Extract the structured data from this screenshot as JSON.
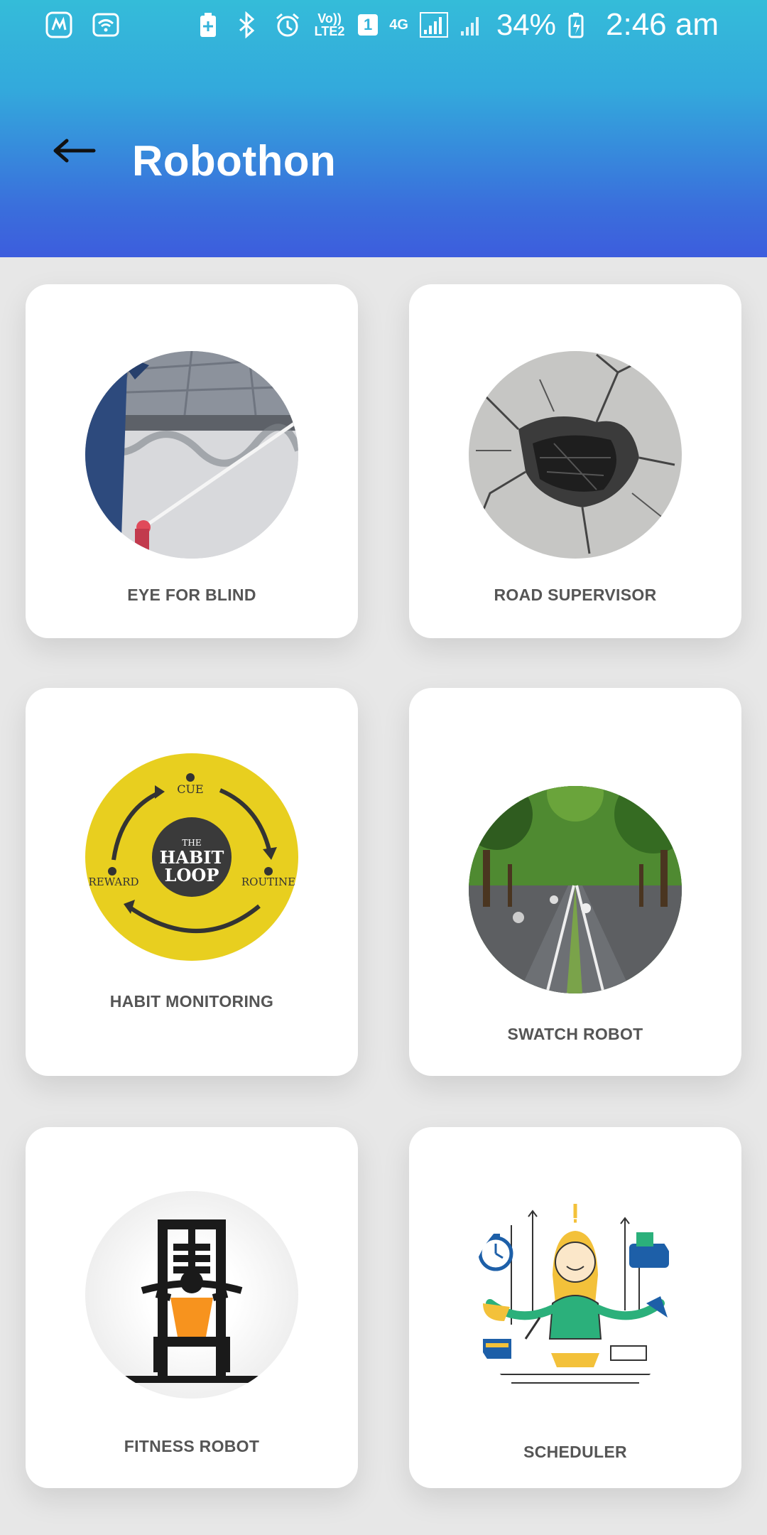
{
  "status_bar": {
    "battery_percent": "34%",
    "time": "2:46 am",
    "network": "4G",
    "volte": "Vo)) LTE2",
    "sim": "1"
  },
  "header": {
    "title": "Robothon",
    "back_icon": "back-arrow-icon"
  },
  "cards": [
    {
      "label": "EYE FOR BLIND",
      "image": "blind-cane-photo"
    },
    {
      "label": "ROAD SUPERVISOR",
      "image": "cracked-road-photo"
    },
    {
      "label": "HABIT MONITORING",
      "image": "habit-loop-diagram",
      "image_text": {
        "center_top": "THE",
        "center_line1": "HABIT",
        "center_line2": "LOOP",
        "cue": "CUE",
        "routine": "ROUTINE",
        "reward": "REWARD"
      }
    },
    {
      "label": "SWATCH ROBOT",
      "image": "tree-lined-road-photo"
    },
    {
      "label": "FITNESS ROBOT",
      "image": "fitness-machine-illustration"
    },
    {
      "label": "SCHEDULER",
      "image": "scheduler-illustration"
    }
  ],
  "colors": {
    "appbar_top": "#34bcd9",
    "appbar_bottom": "#3d5ddd",
    "background": "#e7e7e7",
    "card": "#ffffff",
    "label": "#555555"
  }
}
